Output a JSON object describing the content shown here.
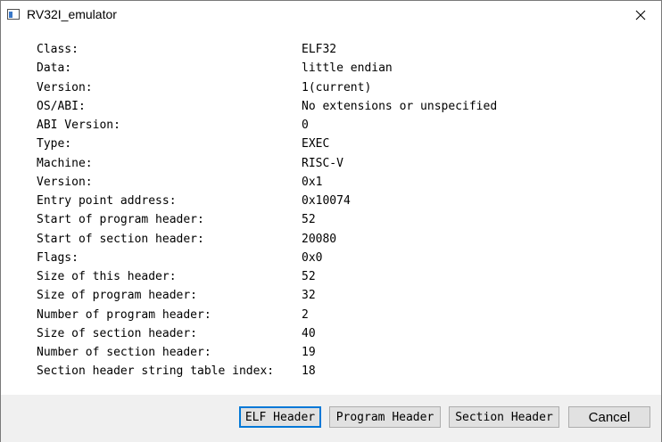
{
  "window": {
    "title": "RV32I_emulator",
    "app_icon": "app-window-icon",
    "close_icon": "close-icon"
  },
  "elf_header": {
    "rows": [
      {
        "label": "Class:",
        "value": "ELF32"
      },
      {
        "label": "Data:",
        "value": "little endian"
      },
      {
        "label": "Version:",
        "value": "1(current)"
      },
      {
        "label": "OS/ABI:",
        "value": "No extensions or unspecified"
      },
      {
        "label": "ABI Version:",
        "value": "0"
      },
      {
        "label": "Type:",
        "value": "EXEC"
      },
      {
        "label": "Machine:",
        "value": "RISC-V"
      },
      {
        "label": "Version:",
        "value": "0x1"
      },
      {
        "label": "Entry point address:",
        "value": "0x10074"
      },
      {
        "label": "Start of program header:",
        "value": "52"
      },
      {
        "label": "Start of section header:",
        "value": "20080"
      },
      {
        "label": "Flags:",
        "value": "0x0"
      },
      {
        "label": "Size of this header:",
        "value": "52"
      },
      {
        "label": "Size of program header:",
        "value": "32"
      },
      {
        "label": "Number of program header:",
        "value": "2"
      },
      {
        "label": "Size of section header:",
        "value": "40"
      },
      {
        "label": "Number of section header:",
        "value": "19"
      },
      {
        "label": "Section header string table index:",
        "value": "18"
      }
    ]
  },
  "buttons": {
    "elf_header": "ELF Header",
    "program_header": "Program Header",
    "section_header": "Section Header",
    "cancel": "Cancel"
  },
  "colors": {
    "focus_border": "#0078d7",
    "footer_bg": "#f0f0f0",
    "button_bg": "#e1e1e1"
  }
}
